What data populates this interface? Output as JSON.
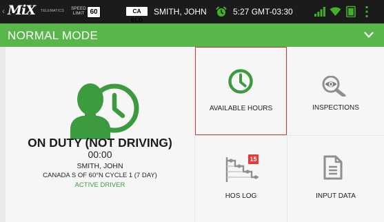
{
  "status_bar": {
    "logo": "MiX",
    "logo_sub": "TELEMATICS",
    "speed_label": "SPEED LIMIT",
    "speed_limit": "60",
    "eld_badge": "CA ELD",
    "driver_name": "SMITH, JOHN",
    "time": "5:27 GMT-03:30"
  },
  "mode_bar": {
    "title": "NORMAL MODE"
  },
  "driver_panel": {
    "duty_status": "ON DUTY (NOT DRIVING)",
    "duty_timer": "00:00",
    "driver_name": "SMITH, JOHN",
    "cycle": "CANADA S OF 60°N CYCLE 1 (7 DAY)",
    "active_label": "ACTIVE DRIVER"
  },
  "tiles": {
    "available_hours": {
      "label": "AVAILABLE HOURS"
    },
    "inspections": {
      "label": "INSPECTIONS"
    },
    "hos_log": {
      "label": "HOS LOG",
      "badge": "15"
    },
    "input_data": {
      "label": "INPUT DATA"
    }
  },
  "colors": {
    "accent_green": "#58b64a",
    "icon_green": "#3d9b3f",
    "selected_border": "#c43c3c",
    "badge_red": "#e53935"
  }
}
